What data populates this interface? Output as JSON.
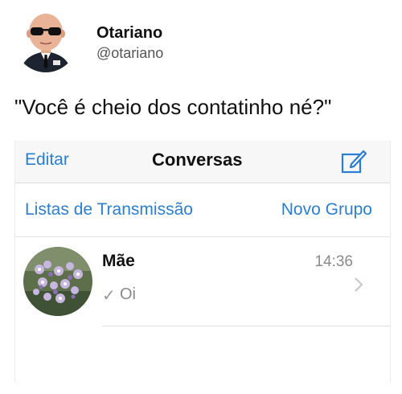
{
  "tweet": {
    "display_name": "Otariano",
    "handle": "@otariano",
    "text": "\"Você é cheio dos contatinho né?\""
  },
  "whatsapp": {
    "nav": {
      "edit_label": "Editar",
      "title": "Conversas",
      "compose_icon": "compose-icon"
    },
    "actions": {
      "broadcast_label": "Listas de Transmissão",
      "new_group_label": "Novo Grupo"
    },
    "chats": [
      {
        "name": "Mãe",
        "time": "14:36",
        "check": "✓",
        "preview": "Oi"
      }
    ],
    "colors": {
      "accent": "#2a7fd4",
      "nav_bg": "#f7f7f7",
      "muted": "#8a8a8a"
    }
  }
}
